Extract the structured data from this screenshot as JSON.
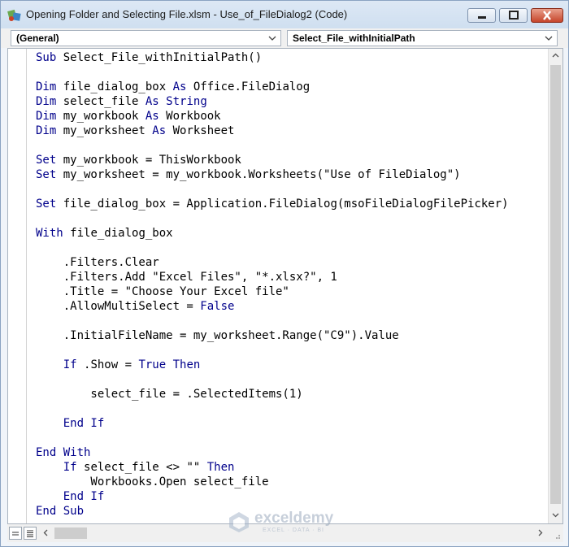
{
  "window": {
    "title": "Opening Folder and Selecting File.xlsm - Use_of_FileDialog2 (Code)"
  },
  "combos": {
    "object": "(General)",
    "procedure": "Select_File_withInitialPath"
  },
  "code_lines": [
    [
      {
        "t": "Sub ",
        "k": 1
      },
      {
        "t": "Select_File_withInitialPath()"
      }
    ],
    [],
    [
      {
        "t": "Dim ",
        "k": 1
      },
      {
        "t": "file_dialog_box "
      },
      {
        "t": "As ",
        "k": 1
      },
      {
        "t": "Office.FileDialog"
      }
    ],
    [
      {
        "t": "Dim ",
        "k": 1
      },
      {
        "t": "select_file "
      },
      {
        "t": "As ",
        "k": 1
      },
      {
        "t": "String",
        "k": 1
      }
    ],
    [
      {
        "t": "Dim ",
        "k": 1
      },
      {
        "t": "my_workbook "
      },
      {
        "t": "As ",
        "k": 1
      },
      {
        "t": "Workbook"
      }
    ],
    [
      {
        "t": "Dim ",
        "k": 1
      },
      {
        "t": "my_worksheet "
      },
      {
        "t": "As ",
        "k": 1
      },
      {
        "t": "Worksheet"
      }
    ],
    [],
    [
      {
        "t": "Set ",
        "k": 1
      },
      {
        "t": "my_workbook = ThisWorkbook"
      }
    ],
    [
      {
        "t": "Set ",
        "k": 1
      },
      {
        "t": "my_worksheet = my_workbook.Worksheets(\"Use of FileDialog\")"
      }
    ],
    [],
    [
      {
        "t": "Set ",
        "k": 1
      },
      {
        "t": "file_dialog_box = Application.FileDialog(msoFileDialogFilePicker)"
      }
    ],
    [],
    [
      {
        "t": "With ",
        "k": 1
      },
      {
        "t": "file_dialog_box"
      }
    ],
    [],
    [
      {
        "t": "    .Filters.Clear"
      }
    ],
    [
      {
        "t": "    .Filters.Add \"Excel Files\", \"*.xlsx?\", 1"
      }
    ],
    [
      {
        "t": "    .Title = \"Choose Your Excel file\""
      }
    ],
    [
      {
        "t": "    .AllowMultiSelect = "
      },
      {
        "t": "False",
        "k": 1
      }
    ],
    [],
    [
      {
        "t": "    .InitialFileName = my_worksheet.Range(\"C9\").Value"
      }
    ],
    [],
    [
      {
        "t": "    "
      },
      {
        "t": "If ",
        "k": 1
      },
      {
        "t": ".Show = "
      },
      {
        "t": "True Then",
        "k": 1
      }
    ],
    [],
    [
      {
        "t": "        select_file = .SelectedItems(1)"
      }
    ],
    [],
    [
      {
        "t": "    "
      },
      {
        "t": "End If",
        "k": 1
      }
    ],
    [],
    [
      {
        "t": "End With",
        "k": 1
      }
    ],
    [
      {
        "t": "    "
      },
      {
        "t": "If ",
        "k": 1
      },
      {
        "t": "select_file <> \"\" "
      },
      {
        "t": "Then",
        "k": 1
      }
    ],
    [
      {
        "t": "        Workbooks.Open select_file"
      }
    ],
    [
      {
        "t": "    "
      },
      {
        "t": "End If",
        "k": 1
      }
    ],
    [
      {
        "t": "End Sub",
        "k": 1
      }
    ]
  ],
  "watermark": {
    "brand": "exceldemy",
    "tagline": "EXCEL · DATA · BI"
  },
  "colors": {
    "keyword": "#00008b",
    "text": "#000000"
  },
  "icons": {
    "app": "vba-project-icon",
    "minimize": "minimize-icon",
    "maximize": "maximize-icon",
    "close": "close-icon"
  }
}
